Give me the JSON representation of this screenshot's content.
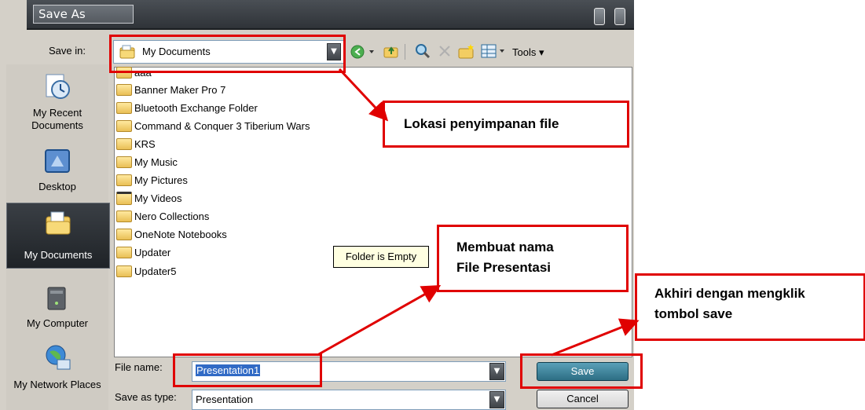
{
  "window": {
    "title": "Save As"
  },
  "toolbar": {
    "save_in_label": "Save in:",
    "save_in_value": "My Documents",
    "tools_label": "Tools"
  },
  "places": [
    {
      "label": "My Recent Documents",
      "icon": "recent-documents-icon"
    },
    {
      "label": "Desktop",
      "icon": "desktop-icon"
    },
    {
      "label": "My Documents",
      "icon": "my-documents-icon",
      "selected": true
    },
    {
      "label": "My Computer",
      "icon": "my-computer-icon"
    },
    {
      "label": "My Network Places",
      "icon": "network-places-icon"
    }
  ],
  "files": [
    {
      "name": "aaa",
      "icon": "folder-icon"
    },
    {
      "name": "Banner Maker Pro 7",
      "icon": "folder-icon"
    },
    {
      "name": "Bluetooth Exchange Folder",
      "icon": "folder-icon"
    },
    {
      "name": "Command & Conquer 3 Tiberium Wars",
      "icon": "folder-icon"
    },
    {
      "name": "KRS",
      "icon": "folder-icon"
    },
    {
      "name": "My Music",
      "icon": "music-folder-icon"
    },
    {
      "name": "My Pictures",
      "icon": "pictures-folder-icon"
    },
    {
      "name": "My Videos",
      "icon": "videos-folder-icon"
    },
    {
      "name": "Nero Collections",
      "icon": "folder-icon"
    },
    {
      "name": "OneNote Notebooks",
      "icon": "folder-icon"
    },
    {
      "name": "Updater",
      "icon": "folder-icon"
    },
    {
      "name": "Updater5",
      "icon": "folder-icon"
    }
  ],
  "tooltip": "Folder is Empty",
  "form": {
    "file_name_label": "File name:",
    "file_name_value": "Presentation1",
    "save_type_label": "Save as type:",
    "save_type_value": "Presentation",
    "save_button": "Save",
    "cancel_button": "Cancel"
  },
  "annotations": {
    "location": "Lokasi penyimpanan file",
    "filename_line1": "Membuat nama",
    "filename_line2": "File Presentasi",
    "save_line1": "Akhiri dengan mengklik",
    "save_line2": "tombol save",
    "color": "#e00000"
  }
}
